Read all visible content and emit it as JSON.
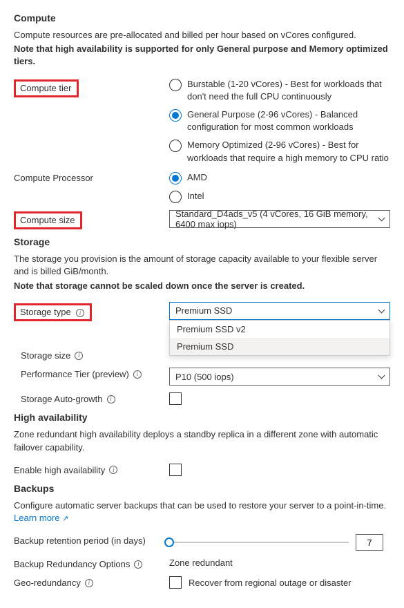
{
  "compute": {
    "heading": "Compute",
    "desc1": "Compute resources are pre-allocated and billed per hour based on vCores configured.",
    "desc2": "Note that high availability is supported for only General purpose and Memory optimized tiers.",
    "tier_label": "Compute tier",
    "tiers": [
      "Burstable (1-20 vCores) - Best for workloads that don't need the full CPU continuously",
      "General Purpose (2-96 vCores) - Balanced configuration for most common workloads",
      "Memory Optimized (2-96 vCores) - Best for workloads that require a high memory to CPU ratio"
    ],
    "processor_label": "Compute Processor",
    "processors": [
      "AMD",
      "Intel"
    ],
    "size_label": "Compute size",
    "size_value": "Standard_D4ads_v5 (4 vCores, 16 GiB memory, 6400 max iops)"
  },
  "storage": {
    "heading": "Storage",
    "desc1": "The storage you provision is the amount of storage capacity available to your flexible server and is billed GiB/month.",
    "desc2": "Note that storage cannot be scaled down once the server is created.",
    "type_label": "Storage type",
    "type_value": "Premium SSD",
    "type_options": [
      "Premium SSD v2",
      "Premium SSD"
    ],
    "size_label": "Storage size",
    "perf_label": "Performance Tier (preview)",
    "perf_value": "P10 (500 iops)",
    "autogrow_label": "Storage Auto-growth"
  },
  "ha": {
    "heading": "High availability",
    "desc": "Zone redundant high availability deploys a standby replica in a different zone with automatic failover capability.",
    "enable_label": "Enable high availability"
  },
  "backups": {
    "heading": "Backups",
    "desc": "Configure automatic server backups that can be used to restore your server to a point-in-time.",
    "learn_more": "Learn more",
    "retention_label": "Backup retention period (in days)",
    "retention_value": "7",
    "redundancy_label": "Backup Redundancy Options",
    "redundancy_value": "Zone redundant",
    "geo_label": "Geo-redundancy",
    "geo_text": "Recover from regional outage or disaster"
  }
}
